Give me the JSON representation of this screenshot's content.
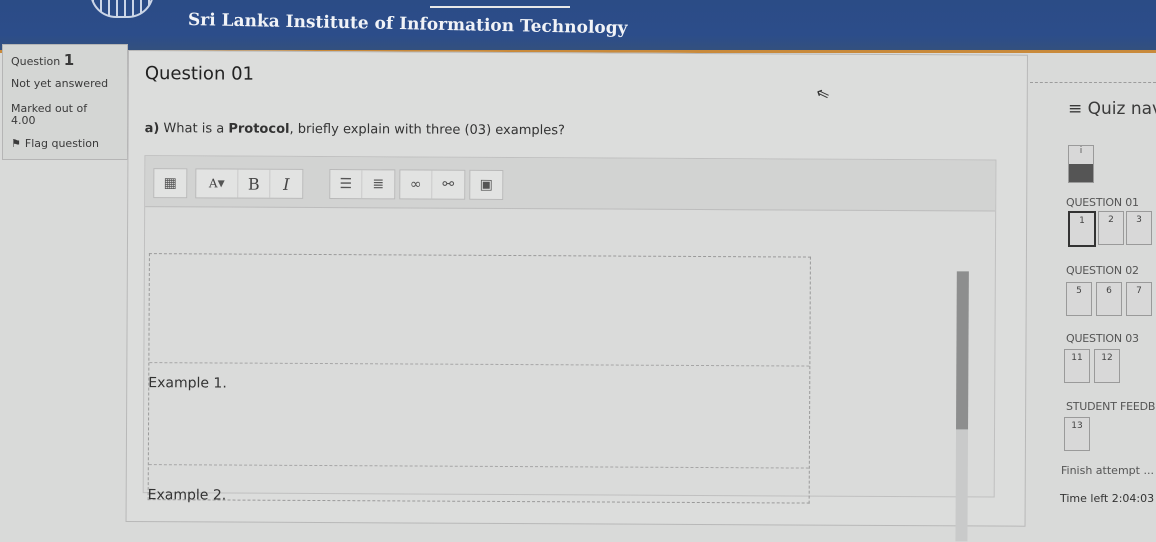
{
  "header": {
    "site_name": "Sri Lanka Institute of Information Technology"
  },
  "question_info": {
    "label": "Question",
    "number": "1",
    "status": "Not yet answered",
    "marked_out_of": "Marked out of 4.00",
    "flag": "Flag question"
  },
  "question": {
    "title": "Question 01",
    "prefix": "a)",
    "text_before": "What is a",
    "keyword": "Protocol",
    "text_after": ", briefly explain with three (03) examples?"
  },
  "editor": {
    "toolbar_icons": [
      "toolbar-toggle-icon",
      "font-size-icon",
      "bold-icon",
      "italic-icon",
      "unordered-list-icon",
      "ordered-list-icon",
      "link-icon",
      "unlink-icon",
      "image-icon"
    ],
    "bold_label": "B",
    "italic_label": "I",
    "font_label": "A",
    "example_1": "Example 1.",
    "example_2": "Example 2."
  },
  "quiz_nav": {
    "title": "≡ Quiz navi",
    "info_tile": "i",
    "sections": [
      {
        "name": "QUESTION 01",
        "items": [
          "1",
          "2",
          "3"
        ]
      },
      {
        "name": "QUESTION 02",
        "items": [
          "5",
          "6",
          "7"
        ]
      },
      {
        "name": "QUESTION 03",
        "items": [
          "11",
          "12"
        ]
      },
      {
        "name": "STUDENT FEEDB",
        "items": [
          "13"
        ]
      }
    ],
    "finish": "Finish attempt ...",
    "time_left": "Time left 2:04:03"
  }
}
